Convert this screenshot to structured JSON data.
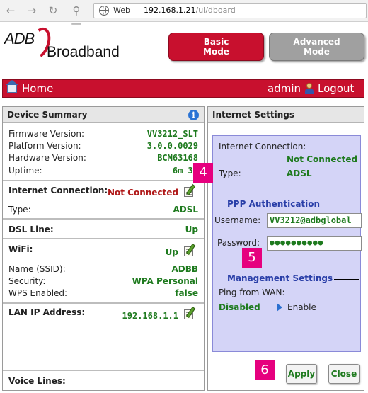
{
  "browser": {
    "web_label": "Web",
    "url_host": "192.168.1.21",
    "url_path": "/ui/dboard"
  },
  "header": {
    "logo_adb": "ADB",
    "logo_broadband": "Broadband",
    "basic_mode_line1": "Basic",
    "basic_mode_line2": "Mode",
    "advanced_mode_line1": "Advanced",
    "advanced_mode_line2": "Mode"
  },
  "topbar": {
    "home": "Home",
    "user": "admin",
    "logout": "Logout"
  },
  "device_summary": {
    "title": "Device Summary",
    "firmware_label": "Firmware Version:",
    "firmware_value": "VV3212_SLT",
    "platform_label": "Platform Version:",
    "platform_value": "3.0.0.0029",
    "hardware_label": "Hardware Version:",
    "hardware_value": "BCM63168",
    "uptime_label": "Uptime:",
    "uptime_value": "6m 37",
    "internet_title": "Internet Connection:",
    "internet_status": "Not Connected",
    "type_label": "Type:",
    "type_value": "ADSL",
    "dsl_title": "DSL Line:",
    "dsl_value": "Up",
    "wifi_title": "WiFi:",
    "wifi_value": "Up",
    "ssid_label": "Name (SSID):",
    "ssid_value": "ADBB",
    "security_label": "Security:",
    "security_value": "WPA Personal",
    "wps_label": "WPS Enabled:",
    "wps_value": "false",
    "lan_title": "LAN IP Address:",
    "lan_value": "192.168.1.1",
    "voice_title": "Voice Lines:"
  },
  "internet_settings": {
    "title": "Internet Settings",
    "connection_label": "Internet Connection:",
    "connection_value": "Not Connected",
    "type_label": "Type:",
    "type_value": "ADSL",
    "ppp_title": "PPP Authentication",
    "username_label": "Username:",
    "username_value": "VV3212@adbglobal",
    "password_label": "Password:",
    "password_value": "●●●●●●●●●●",
    "mgmt_title": "Management Settings",
    "ping_label": "Ping from WAN:",
    "ping_value": "Disabled",
    "enable_label": "Enable",
    "apply_label": "Apply",
    "close_label": "Close"
  },
  "markers": {
    "m4": "4",
    "m5": "5",
    "m6": "6"
  },
  "colors": {
    "brand_red": "#c8102e",
    "value_green": "#1e7a1e",
    "marker_pink": "#e6007e",
    "inner_box_blue": "#d4d4f7"
  }
}
